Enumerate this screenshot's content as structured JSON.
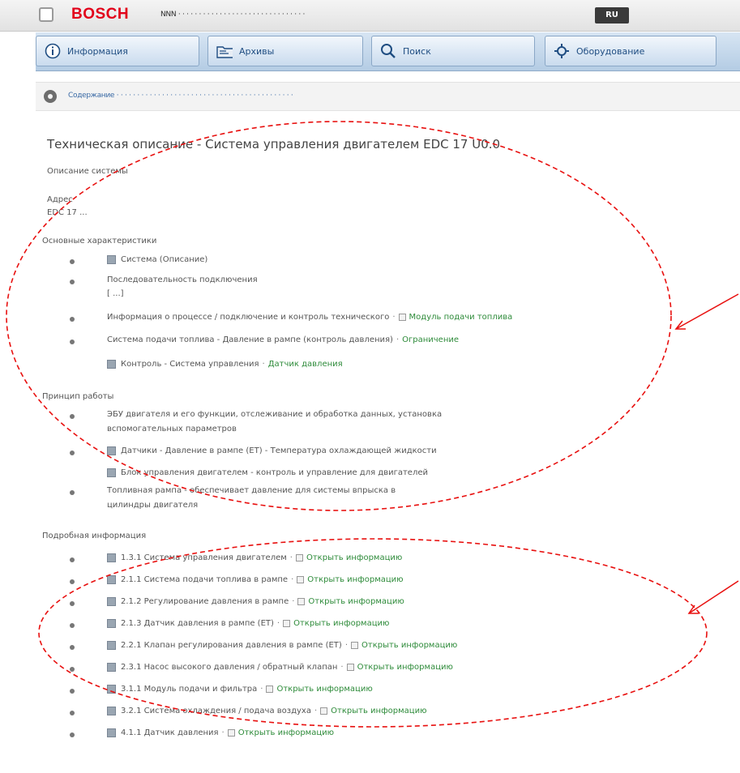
{
  "titlebar": {
    "brand": "BOSCH",
    "crumbs": "NNN · · · · · · · · · · · · · · · · · · · · · · · · · · · · · · ·",
    "lang": "RU"
  },
  "tabs": [
    {
      "label": "Информация",
      "icon": "info-icon"
    },
    {
      "label": "Архивы",
      "icon": "folder-icon"
    },
    {
      "label": "Поиск",
      "icon": "search-icon"
    },
    {
      "label": "Оборудование",
      "icon": "settings-icon"
    }
  ],
  "navstrip": {
    "path": "Содержание · · · · · · · · · · · · · · · · · · · · · · · · · · · · · · · · · · · · · · · · · · ·"
  },
  "document": {
    "title": "Техническая описание - Система управления двигателем EDC 17 U0.0",
    "subtitle": "Описание системы",
    "label_a": "Адрес",
    "value_a": "EDC 17 ...",
    "section_1": "Основные характеристики",
    "section_2": "Принцип работы",
    "section_3": "Подробная информация"
  },
  "items_top": [
    {
      "text": "Система (Описание)",
      "link": ""
    },
    {
      "text": "Последовательность подключения",
      "link": ""
    },
    {
      "text": "[ ...]",
      "link": ""
    },
    {
      "text": "Информация о процессе / подключение и контроль технического",
      "link": "Модуль подачи топлива"
    },
    {
      "text": "Система подачи топлива - Давление в рампе (контроль давления)",
      "link": "Ограничение"
    },
    {
      "text": "Контроль - Система управления",
      "link": "Датчик давления"
    }
  ],
  "items_mid": [
    {
      "text": "ЭБУ двигателя и его функции, отслеживание и обработка данных, установка",
      "link": ""
    },
    {
      "text": "вспомогательных параметров",
      "link": ""
    },
    {
      "text": "Датчики - Давление в рампе (ЕТ) - Температура охлаждающей жидкости",
      "link": ""
    },
    {
      "text": "Блок управления двигателем - контроль и управление для двигателей",
      "link": ""
    },
    {
      "text": "Топливная рампа - обеспечивает давление для системы впрыска в",
      "link": ""
    },
    {
      "text": "цилиндры двигателя",
      "link": ""
    }
  ],
  "items_bottom": [
    {
      "text": "1.3.1 Система управления двигателем",
      "link": "Открыть информацию"
    },
    {
      "text": "2.1.1 Система подачи топлива в рампе",
      "link": "Открыть информацию"
    },
    {
      "text": "2.1.2 Регулирование давления в рампе",
      "link": "Открыть информацию"
    },
    {
      "text": "2.1.3 Датчик давления в рампе (ЕТ)",
      "link": "Открыть информацию"
    },
    {
      "text": "2.2.1 Клапан регулирования давления в рампе (ЕТ)",
      "link": "Открыть информацию"
    },
    {
      "text": "2.3.1 Насос высокого давления / обратный клапан",
      "link": "Открыть информацию"
    },
    {
      "text": "3.1.1 Модуль подачи и фильтра",
      "link": "Открыть информацию"
    },
    {
      "text": "3.2.1 Система охлаждения / подача воздуха",
      "link": "Открыть информацию"
    },
    {
      "text": "4.1.1 Датчик давления",
      "link": "Открыть информацию"
    }
  ],
  "colors": {
    "brand": "#e2001a",
    "tab_text": "#1f4d82",
    "link_green": "#2e8b3a",
    "annotation_red": "#e8100f"
  }
}
